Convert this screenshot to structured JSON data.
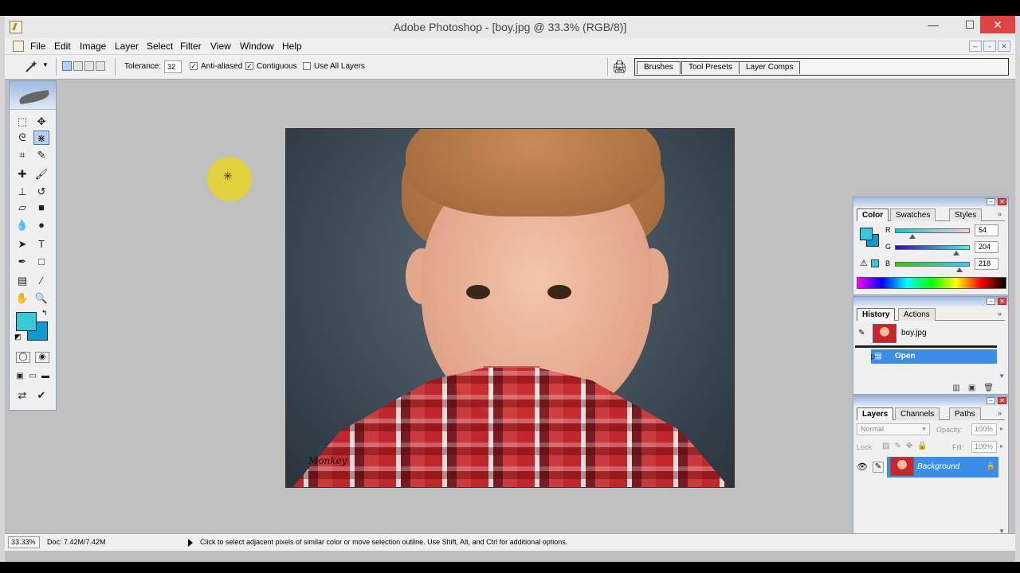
{
  "window": {
    "title": "Adobe Photoshop - [boy.jpg @ 33.3% (RGB/8)]",
    "min": "—",
    "max": "☐",
    "close": "✕"
  },
  "menu": [
    "File",
    "Edit",
    "Image",
    "Layer",
    "Select",
    "Filter",
    "View",
    "Window",
    "Help"
  ],
  "mdi": {
    "min": "–",
    "restore": "▫",
    "close": "✕"
  },
  "options": {
    "tolerance_label": "Tolerance:",
    "tolerance_value": "32",
    "anti_aliased": "Anti-aliased",
    "contiguous": "Contiguous",
    "use_all_layers": "Use All Layers",
    "wells": [
      "Brushes",
      "Tool Presets",
      "Layer Comps"
    ]
  },
  "toolbox": {
    "tools": [
      "marquee-icon",
      "move-icon",
      "lasso-icon",
      "magic-wand-icon",
      "crop-icon",
      "slice-icon",
      "healing-icon",
      "brush-icon",
      "stamp-icon",
      "history-brush-icon",
      "eraser-icon",
      "gradient-icon",
      "blur-icon",
      "dodge-icon",
      "path-select-icon",
      "type-icon",
      "pen-icon",
      "shape-icon",
      "notes-icon",
      "eyedropper-icon",
      "hand-icon",
      "zoom-icon"
    ],
    "foreground_color": "#36cad9",
    "background_color": "#0a9cd6",
    "type_glyph": "T"
  },
  "image": {
    "signature": "Monkey"
  },
  "panels": {
    "color": {
      "tabs": [
        "Color",
        "Swatches",
        "Styles"
      ],
      "r_label": "R",
      "g_label": "G",
      "b_label": "B",
      "r": "54",
      "g": "204",
      "b": "218"
    },
    "history": {
      "tabs": [
        "History",
        "Actions"
      ],
      "snapshot": "boy.jpg",
      "step": "Open"
    },
    "layers": {
      "tabs": [
        "Layers",
        "Channels",
        "Paths"
      ],
      "blend_mode": "Normal",
      "opacity_label": "Opacity:",
      "opacity": "100%",
      "lock_label": "Lock:",
      "fill_label": "Fill:",
      "fill": "100%",
      "layer_name": "Background"
    }
  },
  "status": {
    "zoom": "33.33%",
    "doc": "Doc: 7.42M/7.42M",
    "hint": "Click to select adjacent pixels of similar color or move selection outline.  Use Shift, Alt, and Ctrl for additional options."
  }
}
